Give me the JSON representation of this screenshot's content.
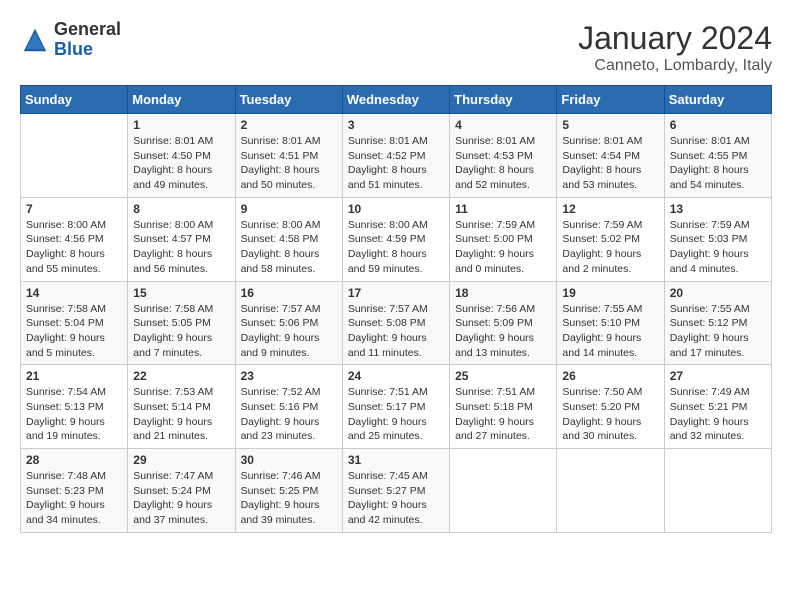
{
  "header": {
    "logo": {
      "general": "General",
      "blue": "Blue"
    },
    "title": "January 2024",
    "subtitle": "Canneto, Lombardy, Italy"
  },
  "calendar": {
    "days_of_week": [
      "Sunday",
      "Monday",
      "Tuesday",
      "Wednesday",
      "Thursday",
      "Friday",
      "Saturday"
    ],
    "weeks": [
      [
        {
          "day": null,
          "sunrise": null,
          "sunset": null,
          "daylight": null
        },
        {
          "day": "1",
          "sunrise": "8:01 AM",
          "sunset": "4:50 PM",
          "daylight": "8 hours and 49 minutes."
        },
        {
          "day": "2",
          "sunrise": "8:01 AM",
          "sunset": "4:51 PM",
          "daylight": "8 hours and 50 minutes."
        },
        {
          "day": "3",
          "sunrise": "8:01 AM",
          "sunset": "4:52 PM",
          "daylight": "8 hours and 51 minutes."
        },
        {
          "day": "4",
          "sunrise": "8:01 AM",
          "sunset": "4:53 PM",
          "daylight": "8 hours and 52 minutes."
        },
        {
          "day": "5",
          "sunrise": "8:01 AM",
          "sunset": "4:54 PM",
          "daylight": "8 hours and 53 minutes."
        },
        {
          "day": "6",
          "sunrise": "8:01 AM",
          "sunset": "4:55 PM",
          "daylight": "8 hours and 54 minutes."
        }
      ],
      [
        {
          "day": "7",
          "sunrise": "8:00 AM",
          "sunset": "4:56 PM",
          "daylight": "8 hours and 55 minutes."
        },
        {
          "day": "8",
          "sunrise": "8:00 AM",
          "sunset": "4:57 PM",
          "daylight": "8 hours and 56 minutes."
        },
        {
          "day": "9",
          "sunrise": "8:00 AM",
          "sunset": "4:58 PM",
          "daylight": "8 hours and 58 minutes."
        },
        {
          "day": "10",
          "sunrise": "8:00 AM",
          "sunset": "4:59 PM",
          "daylight": "8 hours and 59 minutes."
        },
        {
          "day": "11",
          "sunrise": "7:59 AM",
          "sunset": "5:00 PM",
          "daylight": "9 hours and 0 minutes."
        },
        {
          "day": "12",
          "sunrise": "7:59 AM",
          "sunset": "5:02 PM",
          "daylight": "9 hours and 2 minutes."
        },
        {
          "day": "13",
          "sunrise": "7:59 AM",
          "sunset": "5:03 PM",
          "daylight": "9 hours and 4 minutes."
        }
      ],
      [
        {
          "day": "14",
          "sunrise": "7:58 AM",
          "sunset": "5:04 PM",
          "daylight": "9 hours and 5 minutes."
        },
        {
          "day": "15",
          "sunrise": "7:58 AM",
          "sunset": "5:05 PM",
          "daylight": "9 hours and 7 minutes."
        },
        {
          "day": "16",
          "sunrise": "7:57 AM",
          "sunset": "5:06 PM",
          "daylight": "9 hours and 9 minutes."
        },
        {
          "day": "17",
          "sunrise": "7:57 AM",
          "sunset": "5:08 PM",
          "daylight": "9 hours and 11 minutes."
        },
        {
          "day": "18",
          "sunrise": "7:56 AM",
          "sunset": "5:09 PM",
          "daylight": "9 hours and 13 minutes."
        },
        {
          "day": "19",
          "sunrise": "7:55 AM",
          "sunset": "5:10 PM",
          "daylight": "9 hours and 14 minutes."
        },
        {
          "day": "20",
          "sunrise": "7:55 AM",
          "sunset": "5:12 PM",
          "daylight": "9 hours and 17 minutes."
        }
      ],
      [
        {
          "day": "21",
          "sunrise": "7:54 AM",
          "sunset": "5:13 PM",
          "daylight": "9 hours and 19 minutes."
        },
        {
          "day": "22",
          "sunrise": "7:53 AM",
          "sunset": "5:14 PM",
          "daylight": "9 hours and 21 minutes."
        },
        {
          "day": "23",
          "sunrise": "7:52 AM",
          "sunset": "5:16 PM",
          "daylight": "9 hours and 23 minutes."
        },
        {
          "day": "24",
          "sunrise": "7:51 AM",
          "sunset": "5:17 PM",
          "daylight": "9 hours and 25 minutes."
        },
        {
          "day": "25",
          "sunrise": "7:51 AM",
          "sunset": "5:18 PM",
          "daylight": "9 hours and 27 minutes."
        },
        {
          "day": "26",
          "sunrise": "7:50 AM",
          "sunset": "5:20 PM",
          "daylight": "9 hours and 30 minutes."
        },
        {
          "day": "27",
          "sunrise": "7:49 AM",
          "sunset": "5:21 PM",
          "daylight": "9 hours and 32 minutes."
        }
      ],
      [
        {
          "day": "28",
          "sunrise": "7:48 AM",
          "sunset": "5:23 PM",
          "daylight": "9 hours and 34 minutes."
        },
        {
          "day": "29",
          "sunrise": "7:47 AM",
          "sunset": "5:24 PM",
          "daylight": "9 hours and 37 minutes."
        },
        {
          "day": "30",
          "sunrise": "7:46 AM",
          "sunset": "5:25 PM",
          "daylight": "9 hours and 39 minutes."
        },
        {
          "day": "31",
          "sunrise": "7:45 AM",
          "sunset": "5:27 PM",
          "daylight": "9 hours and 42 minutes."
        },
        {
          "day": null,
          "sunrise": null,
          "sunset": null,
          "daylight": null
        },
        {
          "day": null,
          "sunrise": null,
          "sunset": null,
          "daylight": null
        },
        {
          "day": null,
          "sunrise": null,
          "sunset": null,
          "daylight": null
        }
      ]
    ]
  }
}
